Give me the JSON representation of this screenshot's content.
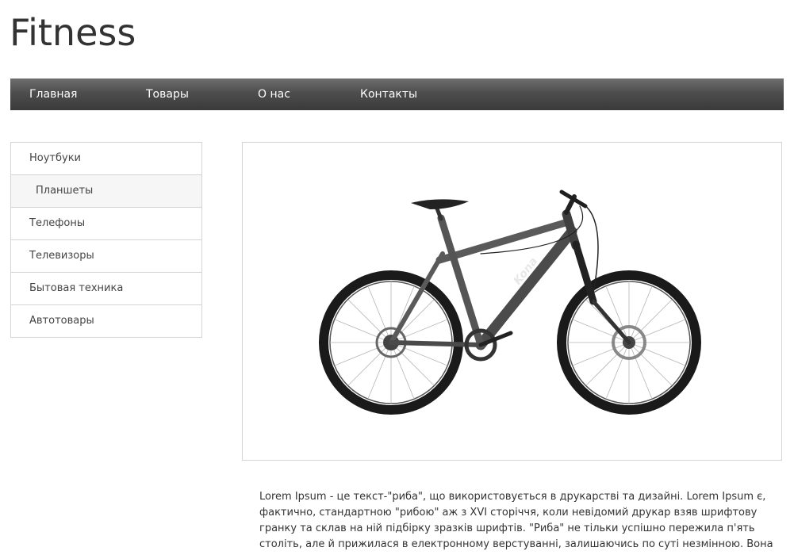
{
  "site": {
    "logo_text": "Fitness"
  },
  "topnav": {
    "items": [
      {
        "label": "Главная"
      },
      {
        "label": "Товары"
      },
      {
        "label": "О нас"
      },
      {
        "label": "Контакты"
      }
    ]
  },
  "sidebar": {
    "items": [
      {
        "label": "Ноутбуки",
        "active": false
      },
      {
        "label": "Планшеты",
        "active": true
      },
      {
        "label": "Телефоны",
        "active": false
      },
      {
        "label": "Телевизоры",
        "active": false
      },
      {
        "label": "Бытовая техника",
        "active": false
      },
      {
        "label": "Автотовары",
        "active": false
      }
    ]
  },
  "product": {
    "image": {
      "icon": "bicycle-image",
      "frame_text": "Kona"
    },
    "description": "Lorem Ipsum - це текст-\"риба\", що використовується в друкарстві та дизайні. Lorem Ipsum є, фактично, стандартною \"рибою\" аж з XVI сторіччя, коли невідомий друкар взяв шрифтову гранку та склав на ній підбірку зразків шрифтів. \"Риба\" не тільки успішно пережила п'ять століть, але й прижилася в електронному верстуванні, залишаючись по суті незмінною. Вона"
  }
}
